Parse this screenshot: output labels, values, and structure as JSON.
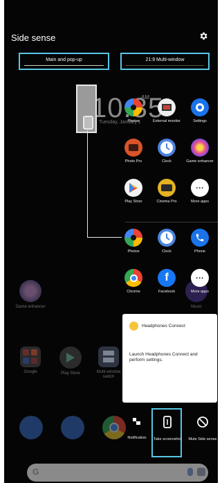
{
  "header": {
    "title": "Side sense",
    "settings_icon": "gear-icon"
  },
  "tabs": [
    {
      "label": "Main and pop-up",
      "selected": true
    },
    {
      "label": "21:9 Multi-window",
      "selected": false
    }
  ],
  "background": {
    "clock": "10:35",
    "ampm": "AM",
    "date": "Tuesday, January 1",
    "apps": [
      {
        "label": "Game enhancer",
        "icon": "game-enhancer-icon"
      },
      {
        "label": "Music",
        "icon": "music-icon"
      },
      {
        "label": "Google",
        "icon": "google-folder-icon"
      },
      {
        "label": "Play Store",
        "icon": "play-store-icon"
      },
      {
        "label": "Multi-window switch",
        "icon": "multi-window-icon"
      }
    ]
  },
  "menu_apps": {
    "row1": [
      {
        "label": "Photos",
        "icon": "photos-icon"
      },
      {
        "label": "External monitor",
        "icon": "external-monitor-icon"
      },
      {
        "label": "Settings",
        "icon": "settings-icon"
      }
    ],
    "row2": [
      {
        "label": "Photo Pro",
        "icon": "photo-pro-icon"
      },
      {
        "label": "Clock",
        "icon": "clock-icon"
      },
      {
        "label": "Game enhancer",
        "icon": "game-enhancer-icon"
      }
    ],
    "row3": [
      {
        "label": "Play Store",
        "icon": "play-store-icon"
      },
      {
        "label": "Cinema Pro",
        "icon": "cinema-pro-icon"
      },
      {
        "label": "More apps",
        "icon": "more-icon"
      }
    ],
    "row4": [
      {
        "label": "Photos",
        "icon": "photos-icon"
      },
      {
        "label": "Clock",
        "icon": "clock-icon"
      },
      {
        "label": "Phone",
        "icon": "phone-icon"
      }
    ],
    "row5": [
      {
        "label": "Chrome",
        "icon": "chrome-icon"
      },
      {
        "label": "Facebook",
        "icon": "facebook-icon"
      },
      {
        "label": "More apps",
        "icon": "more-icon"
      }
    ]
  },
  "popup": {
    "title": "Headphones Connect",
    "text": "Launch Headphones Connect and perform settings."
  },
  "toolbar": [
    {
      "label": "Notification",
      "icon": "notification-icon"
    },
    {
      "label": "Take screenshot",
      "icon": "screenshot-icon"
    },
    {
      "label": "Mute Side sense",
      "icon": "mute-icon"
    }
  ],
  "colors": {
    "highlight": "#59c6e6",
    "background": "#050505"
  }
}
